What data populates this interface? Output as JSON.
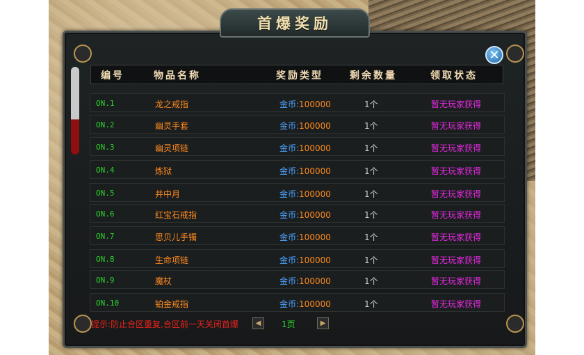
{
  "dialog": {
    "title": "首爆奖励",
    "close_icon": "close-icon"
  },
  "table": {
    "headers": {
      "no": "编号",
      "name": "物品名称",
      "reward": "奖励类型",
      "remaining": "剩余数量",
      "status": "领取状态"
    },
    "rows": [
      {
        "no": "ON.1",
        "name": "龙之戒指",
        "reward_label": "金币:",
        "reward_amount": "100000",
        "count": "1个",
        "status": "暂无玩家获得"
      },
      {
        "no": "ON.2",
        "name": "幽灵手套",
        "reward_label": "金币:",
        "reward_amount": "100000",
        "count": "1个",
        "status": "暂无玩家获得"
      },
      {
        "no": "ON.3",
        "name": "幽灵项链",
        "reward_label": "金币:",
        "reward_amount": "100000",
        "count": "1个",
        "status": "暂无玩家获得"
      },
      {
        "no": "ON.4",
        "name": "炼狱",
        "reward_label": "金币:",
        "reward_amount": "100000",
        "count": "1个",
        "status": "暂无玩家获得"
      },
      {
        "no": "ON.5",
        "name": "井中月",
        "reward_label": "金币:",
        "reward_amount": "100000",
        "count": "1个",
        "status": "暂无玩家获得"
      },
      {
        "no": "ON.6",
        "name": "红宝石戒指",
        "reward_label": "金币:",
        "reward_amount": "100000",
        "count": "1个",
        "status": "暂无玩家获得"
      },
      {
        "no": "ON.7",
        "name": "思贝儿手镯",
        "reward_label": "金币:",
        "reward_amount": "100000",
        "count": "1个",
        "status": "暂无玩家获得"
      },
      {
        "no": "ON.8",
        "name": "生命项链",
        "reward_label": "金币:",
        "reward_amount": "100000",
        "count": "1个",
        "status": "暂无玩家获得"
      },
      {
        "no": "ON.9",
        "name": "魔杖",
        "reward_label": "金币:",
        "reward_amount": "100000",
        "count": "1个",
        "status": "暂无玩家获得"
      },
      {
        "no": "ON.10",
        "name": "铂金戒指",
        "reward_label": "金币:",
        "reward_amount": "100000",
        "count": "1个",
        "status": "暂无玩家获得"
      }
    ]
  },
  "footer": {
    "hint": "提示:防止合区重复,合区前一天关闭首爆",
    "page": "1页",
    "prev_icon": "prev-page-icon",
    "next_icon": "next-page-icon"
  },
  "colors": {
    "number": "#2bd62b",
    "item_name": "#ff8a1f",
    "reward_label": "#4da3ff",
    "status": "#e52ae0",
    "hint": "#e8231b",
    "header_text": "#f2dcb3"
  }
}
